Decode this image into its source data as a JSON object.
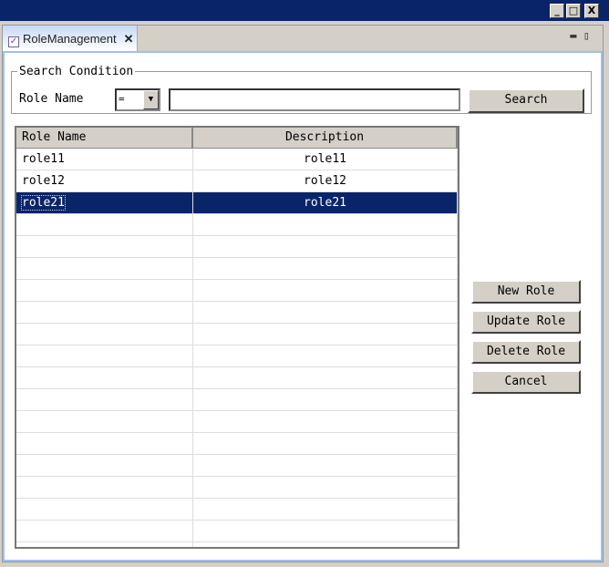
{
  "window": {
    "controls": [
      "minimize",
      "maximize",
      "close"
    ]
  },
  "tab": {
    "label": "RoleManagement",
    "close": "✕"
  },
  "search": {
    "legend": "Search Condition",
    "label": "Role Name",
    "operator": "=",
    "value": "",
    "button": "Search"
  },
  "table": {
    "columns": [
      "Role Name",
      "Description"
    ],
    "rows": [
      {
        "name": "role11",
        "desc": "role11"
      },
      {
        "name": "role12",
        "desc": "role12"
      },
      {
        "name": "role21",
        "desc": "role21"
      }
    ],
    "selected_row": 2
  },
  "actions": {
    "new": "New Role",
    "update": "Update Role",
    "delete": "Delete Role",
    "cancel": "Cancel"
  }
}
